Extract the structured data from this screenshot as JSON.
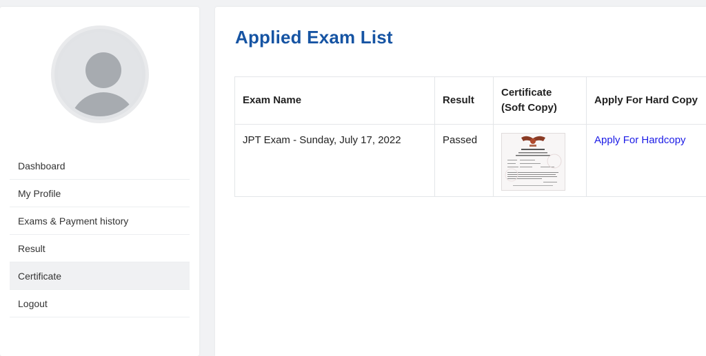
{
  "sidebar": {
    "avatar_icon": "user-avatar-icon",
    "items": [
      {
        "label": "Dashboard",
        "active": false
      },
      {
        "label": "My Profile",
        "active": false
      },
      {
        "label": "Exams & Payment history",
        "active": false
      },
      {
        "label": "Result",
        "active": false
      },
      {
        "label": "Certificate",
        "active": true
      },
      {
        "label": "Logout",
        "active": false
      }
    ]
  },
  "main": {
    "title": "Applied Exam List",
    "title_color": "#1654a3",
    "table": {
      "headers": {
        "exam_name": "Exam Name",
        "result": "Result",
        "certificate_line1": "Certificate",
        "certificate_line2": "(Soft Copy)",
        "apply": "Apply For Hard Copy"
      },
      "rows": [
        {
          "exam_name": "JPT Exam - Sunday, July 17, 2022",
          "result": "Passed",
          "certificate_icon": "certificate-thumbnail",
          "apply_link": "Apply For Hardcopy"
        }
      ]
    },
    "link_color": "#1a1ae6"
  }
}
